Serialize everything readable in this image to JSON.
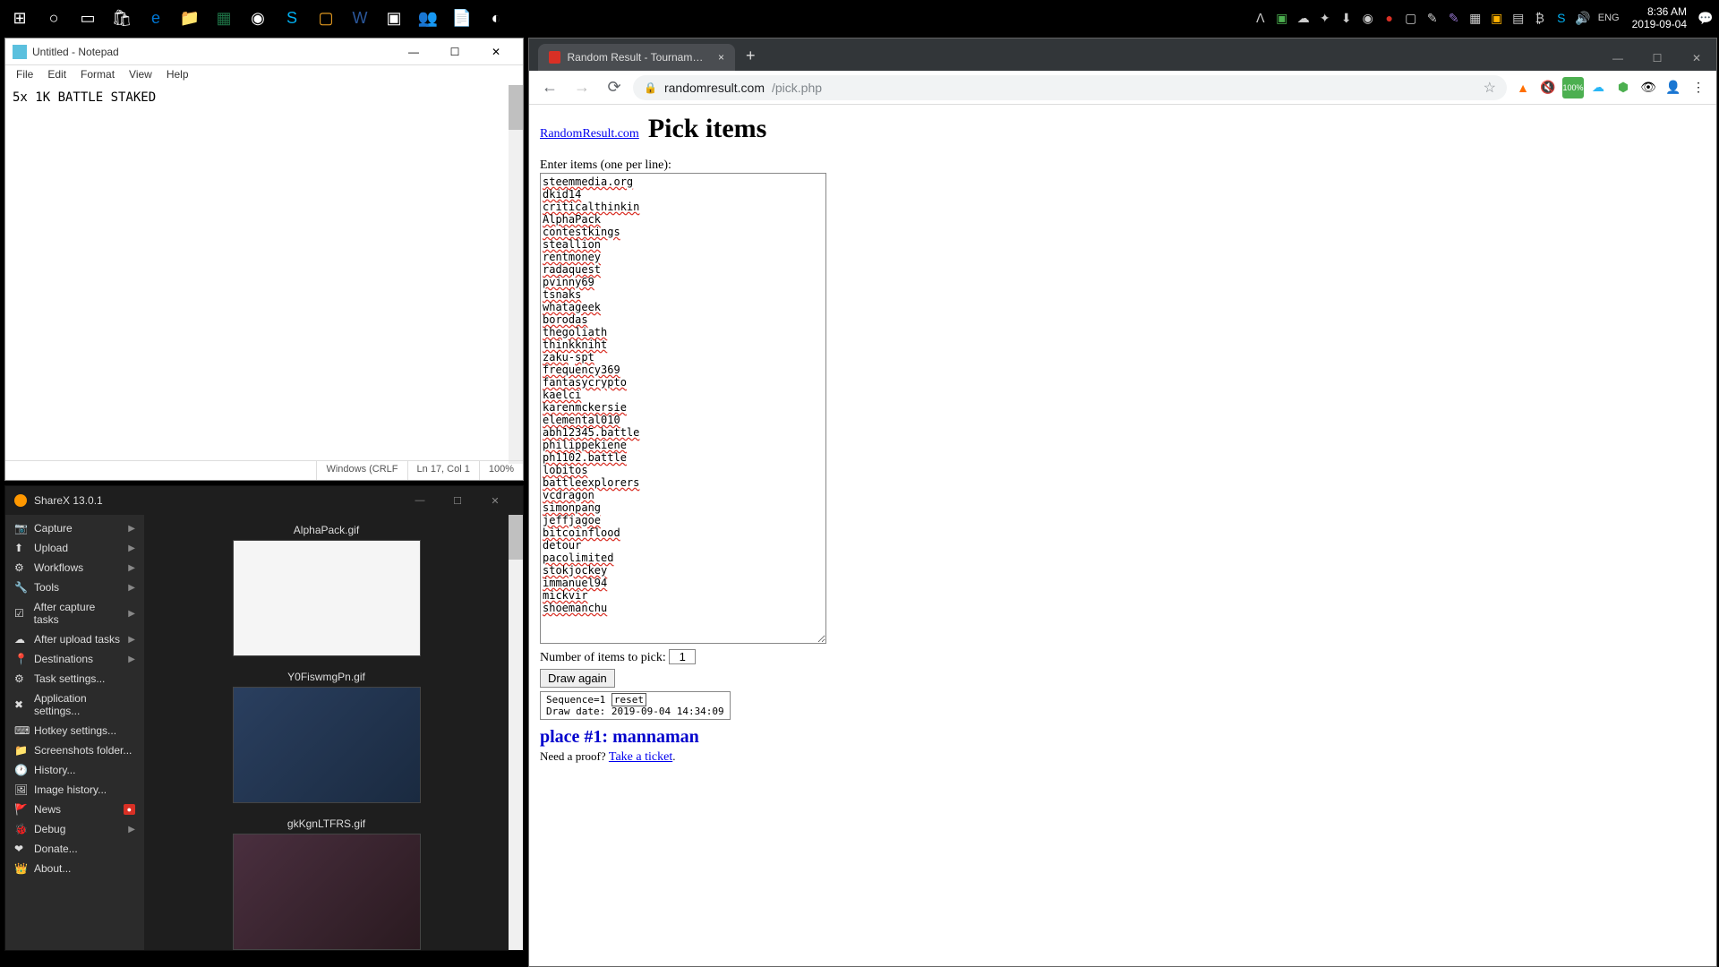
{
  "taskbar": {
    "clock_time": "8:36 AM",
    "clock_date": "2019-09-04",
    "lang": "ENG"
  },
  "notepad": {
    "title": "Untitled - Notepad",
    "menu": [
      "File",
      "Edit",
      "Format",
      "View",
      "Help"
    ],
    "content": "5x 1K BATTLE STAKED",
    "status_enc": "Windows (CRLF",
    "status_pos": "Ln 17, Col 1",
    "status_zoom": "100%",
    "min": "—",
    "max": "☐",
    "close": "✕"
  },
  "sharex": {
    "title": "ShareX 13.0.1",
    "min": "—",
    "max": "☐",
    "close": "✕",
    "sidebar": [
      {
        "icon": "📷",
        "label": "Capture",
        "arrow": "▶"
      },
      {
        "icon": "⬆",
        "label": "Upload",
        "arrow": "▶"
      },
      {
        "icon": "⚙",
        "label": "Workflows",
        "arrow": "▶"
      },
      {
        "icon": "🔧",
        "label": "Tools",
        "arrow": "▶"
      },
      {
        "icon": "☑",
        "label": "After capture tasks",
        "arrow": "▶"
      },
      {
        "icon": "☁",
        "label": "After upload tasks",
        "arrow": "▶"
      },
      {
        "icon": "📍",
        "label": "Destinations",
        "arrow": "▶"
      },
      {
        "icon": "⚙",
        "label": "Task settings...",
        "arrow": ""
      },
      {
        "icon": "✖",
        "label": "Application settings...",
        "arrow": ""
      },
      {
        "icon": "⌨",
        "label": "Hotkey settings...",
        "arrow": ""
      },
      {
        "icon": "📁",
        "label": "Screenshots folder...",
        "arrow": ""
      },
      {
        "icon": "🕐",
        "label": "History...",
        "arrow": ""
      },
      {
        "icon": "🖼",
        "label": "Image history...",
        "arrow": ""
      },
      {
        "icon": "🚩",
        "label": "News",
        "badge": "●"
      },
      {
        "icon": "🐞",
        "label": "Debug",
        "arrow": "▶"
      },
      {
        "icon": "❤",
        "label": "Donate...",
        "arrow": ""
      },
      {
        "icon": "👑",
        "label": "About...",
        "arrow": ""
      }
    ],
    "gallery": [
      {
        "name": "AlphaPack.gif",
        "cls": "thumb-a"
      },
      {
        "name": "Y0FiswmgPn.gif",
        "cls": "thumb-b"
      },
      {
        "name": "gkKgnLTFRS.gif",
        "cls": "thumb-c"
      }
    ]
  },
  "chrome": {
    "tab_title": "Random Result - Tournament dr",
    "tab_close": "×",
    "newtab": "+",
    "min": "—",
    "max": "☐",
    "close": "✕",
    "url_host": "randomresult.com",
    "url_path": "/pick.php",
    "star": "☆",
    "nav_back": "←",
    "nav_fwd": "→",
    "nav_reload": "⟳",
    "lock": "🔒",
    "page": {
      "sitelink": "RandomResult.com",
      "heading": "Pick items",
      "label": "Enter items (one per line):",
      "items": [
        "steemmedia.org",
        "dkid14",
        "criticalthinkin",
        "AlphaPack",
        "contestkings",
        "steallion",
        "rentmoney",
        "radaquest",
        "pvinny69",
        "tsnaks",
        "whatageek",
        "borodas",
        "thegoliath",
        "thinkkniht",
        "zaku-spt",
        "frequency369",
        "fantasycrypto",
        "kaelci",
        "karenmckersie",
        "elemental010",
        "abh12345.battle",
        "philippekiene",
        "ph1102.battle",
        "lobitos",
        "battleexplorers",
        "vcdragon",
        "simonpang",
        "jeffjagoe",
        "bitcoinflood",
        "detour",
        "pacolimited",
        "stokjockey",
        "immanuel94",
        "mickvir",
        "shoemanchu"
      ],
      "plain_items": {
        "detour": 1
      },
      "pick_label": "Number of items to pick:",
      "pick_value": "1",
      "draw_btn": "Draw again",
      "seq": "Sequence=1 ",
      "reset": "reset",
      "drawdate": "Draw date: 2019-09-04 14:34:09",
      "result": "place #1: mannaman",
      "proof": "Need a proof? ",
      "ticket": "Take a ticket",
      "period": "."
    }
  }
}
